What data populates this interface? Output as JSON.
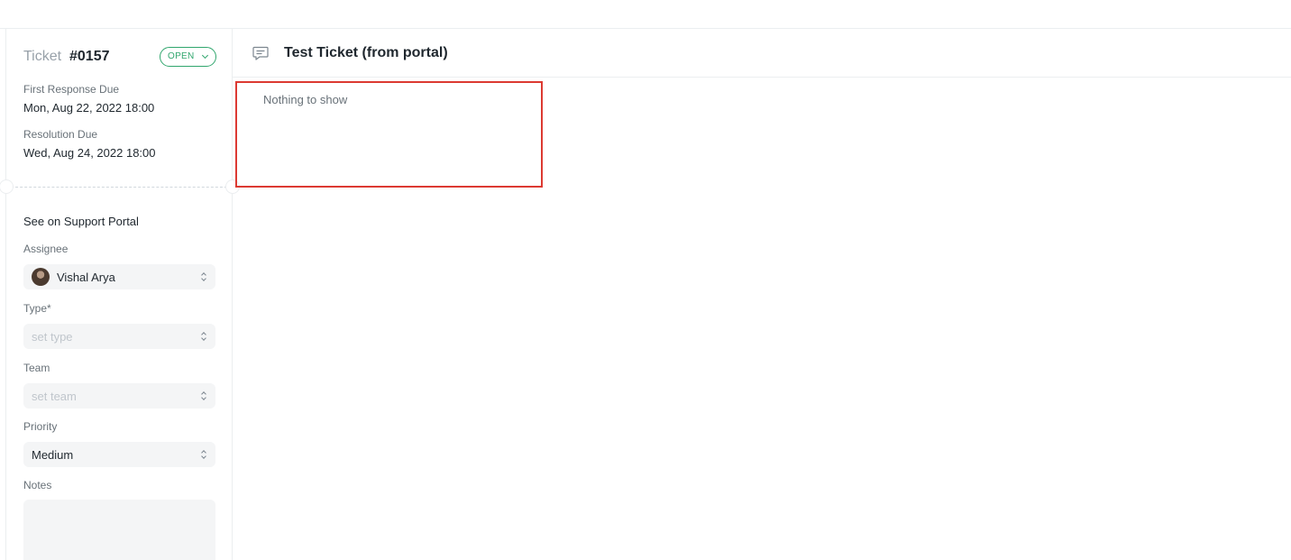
{
  "ticket": {
    "word": "Ticket",
    "number": "#0157",
    "status": "OPEN",
    "first_response_label": "First Response Due",
    "first_response_value": "Mon, Aug 22, 2022 18:00",
    "resolution_label": "Resolution Due",
    "resolution_value": "Wed, Aug 24, 2022 18:00"
  },
  "sidebar": {
    "portal_link": "See on Support Portal",
    "assignee_label": "Assignee",
    "assignee_value": "Vishal Arya",
    "type_label": "Type*",
    "type_placeholder": "set type",
    "team_label": "Team",
    "team_placeholder": "set team",
    "priority_label": "Priority",
    "priority_value": "Medium",
    "notes_label": "Notes"
  },
  "main": {
    "title": "Test Ticket (from portal)",
    "empty_text": "Nothing to show"
  },
  "colors": {
    "status_green": "#30a66d",
    "highlight_red": "#dc3a32"
  },
  "icons": [
    "chat-bubble-icon",
    "chevron-down-icon",
    "select-arrows-icon",
    "avatar"
  ]
}
